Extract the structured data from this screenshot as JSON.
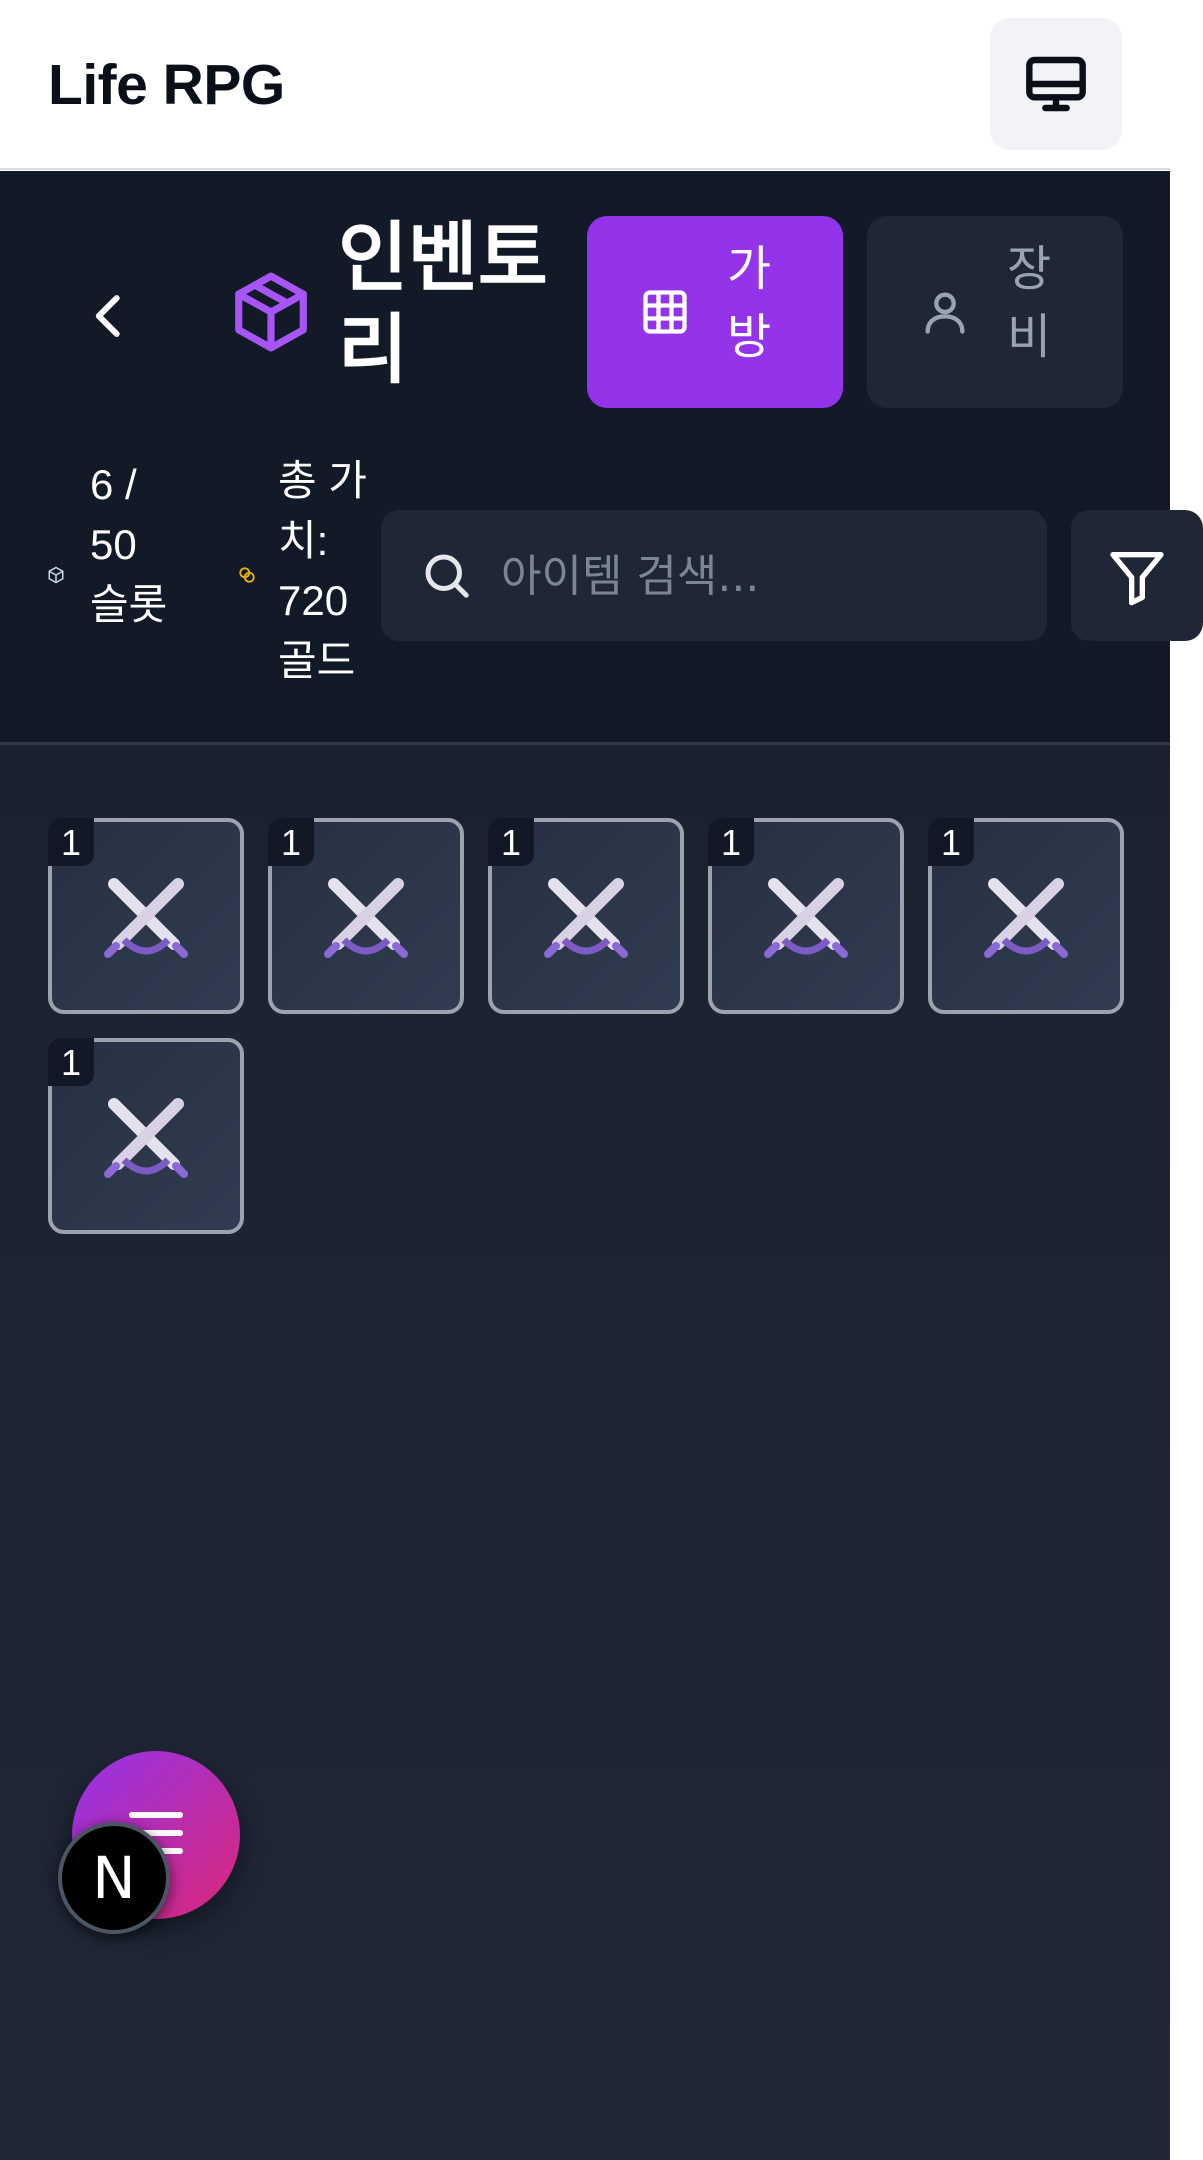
{
  "app": {
    "title": "Life RPG"
  },
  "icons": {
    "monitor": "monitor-icon",
    "back": "chevron-left-icon",
    "package": "package-icon",
    "grid": "grid-icon",
    "user": "user-icon",
    "search": "search-icon",
    "filter": "filter-icon",
    "menu": "menu-icon",
    "item": "crossed-swords-icon"
  },
  "colors": {
    "accent": "#9333ea",
    "header_bg": "#121927",
    "panel_bg": "#1b2230",
    "slot_border": "#9ca3af",
    "fab_gradient_start": "#9333ea",
    "fab_gradient_end": "#db2777"
  },
  "inventory": {
    "title": "인벤토리",
    "tabs": [
      {
        "label": "가방",
        "active": true
      },
      {
        "label": "장비",
        "active": false
      }
    ],
    "stats": {
      "slots": "6 / 50 슬롯",
      "total_value": "총 가치: 720 골드"
    },
    "search": {
      "placeholder": "아이템 검색..."
    },
    "items": [
      {
        "quantity": "1"
      },
      {
        "quantity": "1"
      },
      {
        "quantity": "1"
      },
      {
        "quantity": "1"
      },
      {
        "quantity": "1"
      },
      {
        "quantity": "1"
      }
    ]
  },
  "fab": {
    "icon": "menu-icon"
  },
  "dev_badge": {
    "label": "N"
  }
}
